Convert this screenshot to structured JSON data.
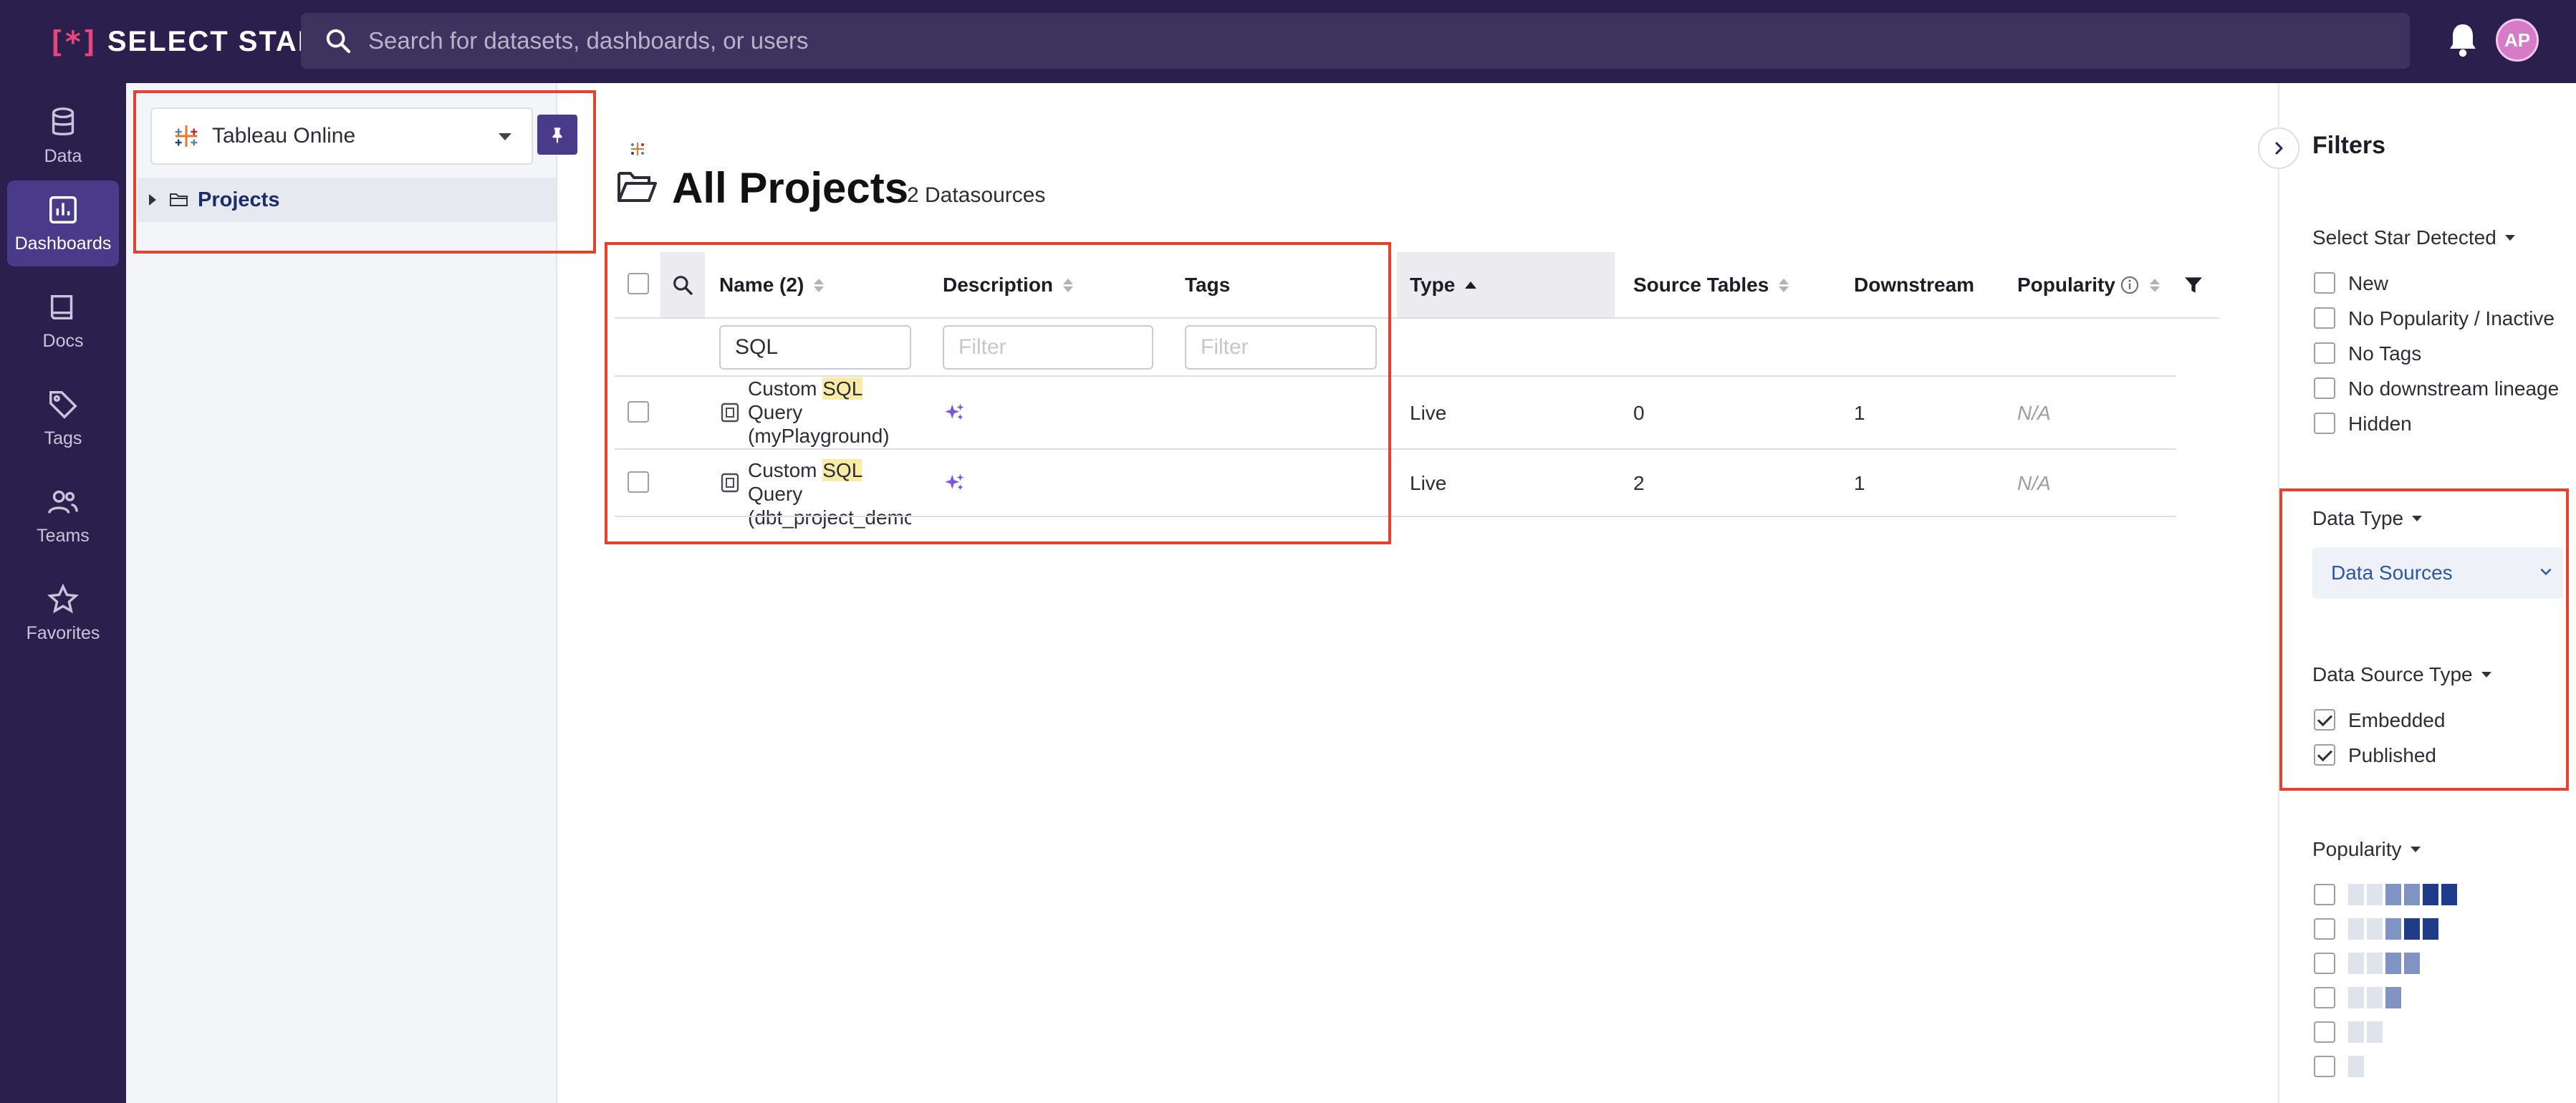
{
  "header": {
    "logo_mark": "[*]",
    "logo_text": "SELECT STAR",
    "search_placeholder": "Search for datasets, dashboards, or users",
    "avatar_initials": "AP"
  },
  "nav": [
    {
      "label": "Data",
      "icon": "database-icon",
      "active": false
    },
    {
      "label": "Dashboards",
      "icon": "bar-chart-icon",
      "active": true
    },
    {
      "label": "Docs",
      "icon": "book-icon",
      "active": false
    },
    {
      "label": "Tags",
      "icon": "tag-icon",
      "active": false
    },
    {
      "label": "Teams",
      "icon": "users-icon",
      "active": false
    },
    {
      "label": "Favorites",
      "icon": "star-icon",
      "active": false
    }
  ],
  "sidebar": {
    "source_label": "Tableau Online",
    "tree_root": "Projects"
  },
  "main": {
    "title": "All Projects",
    "count": "2 Datasources",
    "columns": {
      "name": "Name (2)",
      "description": "Description",
      "tags": "Tags",
      "type": "Type",
      "source_tables": "Source Tables",
      "downstream": "Downstream",
      "popularity": "Popularity"
    },
    "filters": {
      "name_value": "SQL",
      "description_placeholder": "Filter",
      "tags_placeholder": "Filter"
    },
    "rows": [
      {
        "name_pre": "Custom ",
        "name_hl": "SQL",
        "name_post1": "Query",
        "name_post2": "(myPlayground)",
        "type": "Live",
        "source_tables": "0",
        "downstream": "1",
        "popularity": "N/A"
      },
      {
        "name_pre": "Custom ",
        "name_hl": "SQL",
        "name_post1": " Query",
        "name_post2": "(dbt_project_demo",
        "type": "Live",
        "source_tables": "2",
        "downstream": "1",
        "popularity": "N/A"
      }
    ]
  },
  "filter_panel": {
    "title": "Filters",
    "detected_section": "Select Star Detected",
    "detected_options": [
      "New",
      "No Popularity / Inactive",
      "No Tags",
      "No downstream lineage",
      "Hidden"
    ],
    "data_type_section": "Data Type",
    "data_type_value": "Data Sources",
    "source_type_section": "Data Source Type",
    "source_type_options": [
      {
        "label": "Embedded",
        "checked": true
      },
      {
        "label": "Published",
        "checked": true
      }
    ],
    "popularity_section": "Popularity",
    "popularity_levels": [
      6,
      5,
      4,
      3,
      2,
      1
    ]
  },
  "colors": {
    "nav_bg": "#2b1f4d",
    "accent": "#4a3a8a",
    "highlight": "#fbeba4",
    "annotation": "#e5412d"
  }
}
